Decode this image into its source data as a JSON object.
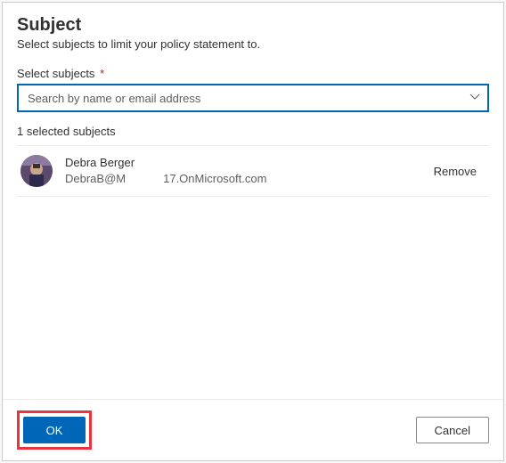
{
  "header": {
    "title": "Subject",
    "subtitle": "Select subjects to limit your policy statement to."
  },
  "field": {
    "label": "Select subjects",
    "required_marker": "*",
    "placeholder": "Search by name or email address"
  },
  "selection": {
    "count_text": "1 selected subjects",
    "items": [
      {
        "name": "Debra Berger",
        "email_part1": "DebraB@M",
        "email_part2": "17.OnMicrosoft.com",
        "remove_label": "Remove"
      }
    ]
  },
  "footer": {
    "ok": "OK",
    "cancel": "Cancel"
  }
}
